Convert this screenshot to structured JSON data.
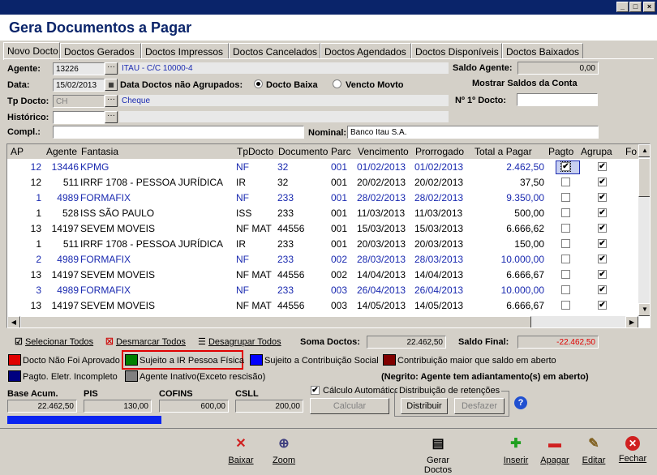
{
  "window": {
    "min_icon": "minimize-icon",
    "max_icon": "restore-icon",
    "close_icon": "close-icon"
  },
  "title": "Gera Documentos a Pagar",
  "tabs": [
    "Novo Docto",
    "Doctos Gerados",
    "Doctos Impressos",
    "Doctos Cancelados",
    "Doctos Agendados",
    "Doctos Disponíveis",
    "Doctos Baixados"
  ],
  "form": {
    "agente_label": "Agente:",
    "agente_value": "13226",
    "agente_desc": "ITAU - C/C 10000-4",
    "data_label": "Data:",
    "data_value": "15/02/2013",
    "agrupados_label": "Data Doctos não Agrupados:",
    "opt_baixa": "Docto Baixa",
    "opt_vencto": "Vencto Movto",
    "tpdocto_label": "Tp Docto:",
    "tpdocto_value": "CH",
    "tpdocto_desc": "Cheque",
    "historico_label": "Histórico:",
    "compl_label": "Compl.:",
    "nominal_label": "Nominal:",
    "nominal_value": "Banco Itau S.A.",
    "saldo_agente_label": "Saldo Agente:",
    "saldo_agente_value": "0,00",
    "mostrar_saldos": "Mostrar Saldos da Conta",
    "primeiro_docto_label": "Nº 1º Docto:",
    "primeiro_docto_value": "",
    "dots": "···"
  },
  "grid": {
    "headers": [
      "AP",
      "Agente",
      "Fantasia",
      "TpDocto",
      "Documento",
      "Parc",
      "Vencimento",
      "Prorrogado",
      "Total a Pagar",
      "Pagto",
      "Agrupa",
      "Fo"
    ],
    "rows": [
      {
        "ap": "12",
        "agente": "13446",
        "fantasia": "KPMG",
        "tp": "NF",
        "doc": "32",
        "parc": "001",
        "venc": "01/02/2013",
        "prorr": "01/02/2013",
        "total": "2.462,50",
        "pagto": "✔",
        "agrupa": "✔",
        "blue": true,
        "selected": true
      },
      {
        "ap": "12",
        "agente": "511",
        "fantasia": "IRRF 1708 - PESSOA JURÍDICA",
        "tp": "IR",
        "doc": "32",
        "parc": "001",
        "venc": "20/02/2013",
        "prorr": "20/02/2013",
        "total": "37,50",
        "pagto": "",
        "agrupa": "✔",
        "blue": false
      },
      {
        "ap": "1",
        "agente": "4989",
        "fantasia": "FORMAFIX",
        "tp": "NF",
        "doc": "233",
        "parc": "001",
        "venc": "28/02/2013",
        "prorr": "28/02/2013",
        "total": "9.350,00",
        "pagto": "",
        "agrupa": "✔",
        "blue": true
      },
      {
        "ap": "1",
        "agente": "528",
        "fantasia": "ISS SÃO PAULO",
        "tp": "ISS",
        "doc": "233",
        "parc": "001",
        "venc": "11/03/2013",
        "prorr": "11/03/2013",
        "total": "500,00",
        "pagto": "",
        "agrupa": "✔",
        "blue": false
      },
      {
        "ap": "13",
        "agente": "14197",
        "fantasia": "SEVEM MOVEIS",
        "tp": "NF MAT",
        "doc": "44556",
        "parc": "001",
        "venc": "15/03/2013",
        "prorr": "15/03/2013",
        "total": "6.666,62",
        "pagto": "",
        "agrupa": "✔",
        "blue": false
      },
      {
        "ap": "1",
        "agente": "511",
        "fantasia": "IRRF 1708 - PESSOA JURÍDICA",
        "tp": "IR",
        "doc": "233",
        "parc": "001",
        "venc": "20/03/2013",
        "prorr": "20/03/2013",
        "total": "150,00",
        "pagto": "",
        "agrupa": "✔",
        "blue": false
      },
      {
        "ap": "2",
        "agente": "4989",
        "fantasia": "FORMAFIX",
        "tp": "NF",
        "doc": "233",
        "parc": "002",
        "venc": "28/03/2013",
        "prorr": "28/03/2013",
        "total": "10.000,00",
        "pagto": "",
        "agrupa": "✔",
        "blue": true
      },
      {
        "ap": "13",
        "agente": "14197",
        "fantasia": "SEVEM MOVEIS",
        "tp": "NF MAT",
        "doc": "44556",
        "parc": "002",
        "venc": "14/04/2013",
        "prorr": "14/04/2013",
        "total": "6.666,67",
        "pagto": "",
        "agrupa": "✔",
        "blue": false
      },
      {
        "ap": "3",
        "agente": "4989",
        "fantasia": "FORMAFIX",
        "tp": "NF",
        "doc": "233",
        "parc": "003",
        "venc": "26/04/2013",
        "prorr": "26/04/2013",
        "total": "10.000,00",
        "pagto": "",
        "agrupa": "✔",
        "blue": true
      },
      {
        "ap": "13",
        "agente": "14197",
        "fantasia": "SEVEM MOVEIS",
        "tp": "NF MAT",
        "doc": "44556",
        "parc": "003",
        "venc": "14/05/2013",
        "prorr": "14/05/2013",
        "total": "6.666,67",
        "pagto": "",
        "agrupa": "✔",
        "blue": false
      }
    ]
  },
  "actions": {
    "selecionar": "Selecionar Todos",
    "desmarcar": "Desmarcar Todos",
    "desagrupar": "Desagrupar Todos"
  },
  "totals": {
    "soma_label": "Soma Doctos:",
    "soma_value": "22.462,50",
    "saldo_final_label": "Saldo Final:",
    "saldo_final_value": "-22.462,50"
  },
  "legend": {
    "nao_aprovado": "Docto Não Foi Aprovado",
    "sujeito_ir": "Sujeito a IR Pessoa Física",
    "sujeito_cs": "Sujeito a Contribuição Social",
    "contrib_maior": "Contribuição maior que saldo em aberto",
    "pagto_eletr": "Pagto. Eletr. Incompleto",
    "agente_inativo": "Agente Inativo(Exceto rescisão)",
    "negrito": "(Negrito: Agente tem adiantamento(s) em aberto)",
    "colors": {
      "red": "#e00000",
      "green": "#008000",
      "blue": "#0000ff",
      "darkred": "#800000",
      "navy": "#000080",
      "gray": "#808080"
    }
  },
  "base": {
    "base_label": "Base Acum.",
    "base_value": "22.462,50",
    "pis_label": "PIS",
    "pis_value": "130,00",
    "cofins_label": "COFINS",
    "cofins_value": "600,00",
    "csll_label": "CSLL",
    "csll_value": "200,00"
  },
  "calc": {
    "auto_label": "Cálculo Automático",
    "calcular": "Calcular",
    "distrib_group": "Distribuição de retenções",
    "distribuir": "Distribuir",
    "desfazer": "Desfazer"
  },
  "toolbar": {
    "baixar": "Baixar",
    "zoom": "Zoom",
    "gerar": "Gerar",
    "gerar2": "Doctos",
    "inserir": "Inserir",
    "apagar": "Apagar",
    "editar": "Editar",
    "fechar": "Fechar"
  }
}
